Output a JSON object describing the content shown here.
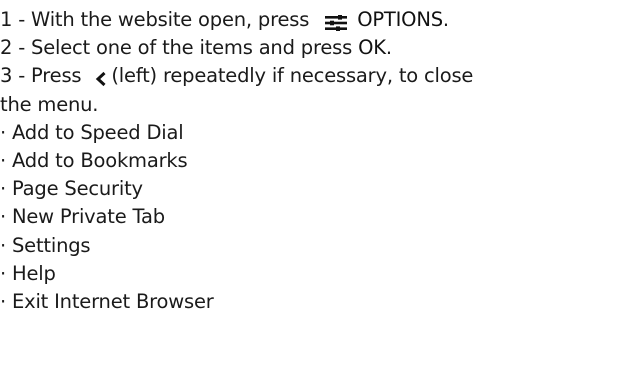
{
  "steps": [
    {
      "prefix": "1 -  With the website open, press ",
      "icon": "sliders-options-icon",
      "key": "OPTIONS",
      "suffix": "."
    },
    {
      "prefix": "2 -  Select one of the items and press ",
      "key": "OK",
      "suffix": "."
    },
    {
      "prefix": "3 -  Press ",
      "icon": "chevron-left-icon",
      "suffix": "(left) repeatedly if necessary, to close",
      "continuation": "the menu."
    }
  ],
  "bullet_char": "·",
  "items": [
    "Add to Speed Dial",
    "Add to Bookmarks",
    "Page Security",
    "New Private Tab",
    "Settings",
    "Help",
    "Exit Internet Browser"
  ]
}
